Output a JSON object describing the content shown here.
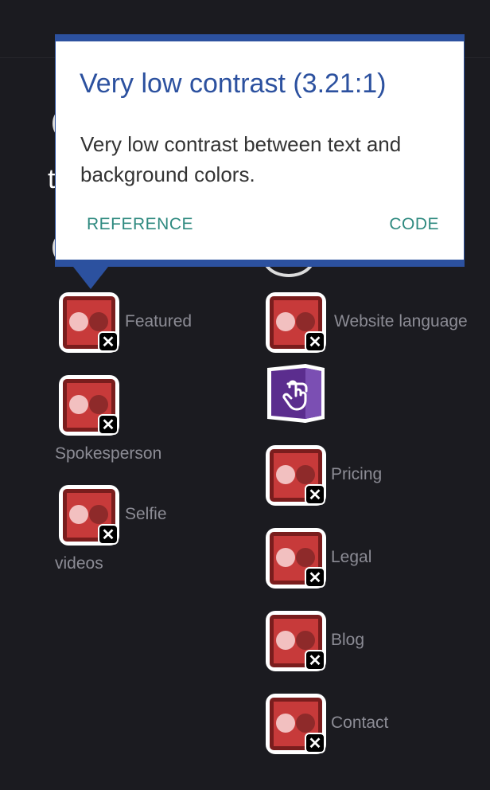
{
  "tooltip": {
    "title": "Very low contrast (3.21:1)",
    "description": "Very low contrast between text and background colors.",
    "reference_label": "REFERENCE",
    "code_label": "CODE",
    "accent_color": "#2c519f"
  },
  "background": {
    "partial_text": "t"
  },
  "links_left": [
    {
      "label": "Featured"
    },
    {
      "label": "Spokesperson"
    },
    {
      "label": "Selfie"
    },
    {
      "label": "videos"
    }
  ],
  "links_right": [
    {
      "label": "Website language"
    },
    {
      "label": "Pricing"
    },
    {
      "label": "Legal"
    },
    {
      "label": "Blog"
    },
    {
      "label": "Contact"
    }
  ],
  "icons": {
    "error_badge": "contrast-error-icon",
    "close": "close-icon",
    "alert": "aria-touch-alert-icon"
  },
  "colors": {
    "page_bg": "#1b1b20",
    "link_text": "#8c8c95",
    "error_red": "#c73a3a",
    "alert_purple": "#5b2d8e"
  }
}
